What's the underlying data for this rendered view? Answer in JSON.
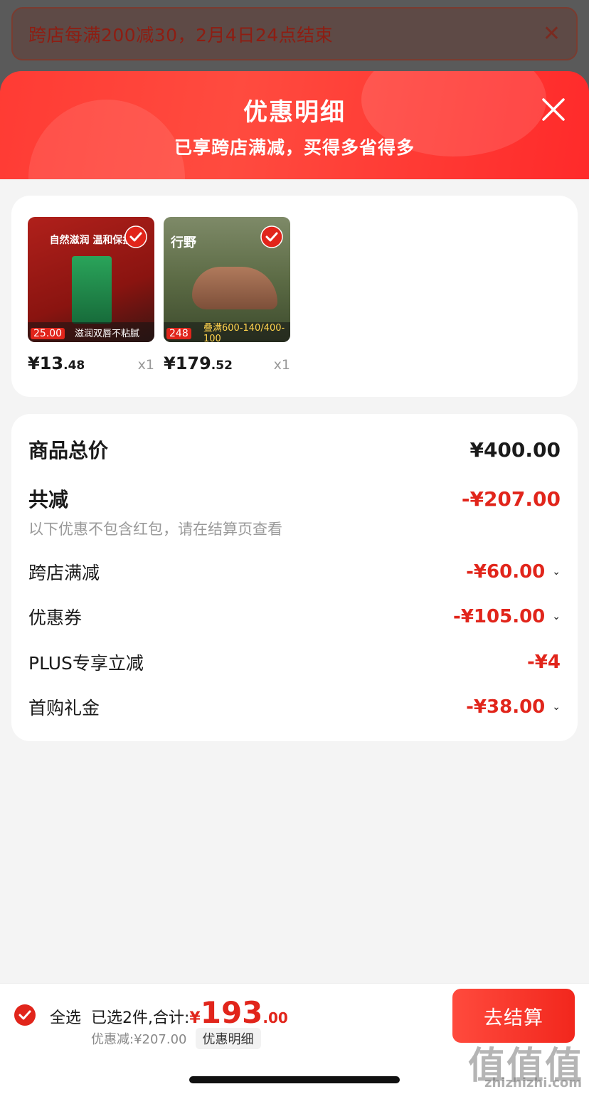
{
  "promo_banner": {
    "text": "跨店每满200减30，2月4日24点结束",
    "close_icon": "close-icon"
  },
  "sheet": {
    "title": "优惠明细",
    "subtitle": "已享跨店满减，买得多省得多"
  },
  "products": [
    {
      "price_int": "¥13",
      "price_dec": ".48",
      "qty": "x1",
      "slogan": "自然滋润 温和保护",
      "caption": "滋润双唇不粘腻",
      "tag_price": "25.00",
      "selected": true
    },
    {
      "price_int": "¥179",
      "price_dec": ".52",
      "qty": "x1",
      "slogan": "行野",
      "caption": "叠满600-140/400-100",
      "tag_price": "248",
      "selected": true
    }
  ],
  "summary": {
    "total_label": "商品总价",
    "total_value": "¥400.00",
    "reduce_label": "共减",
    "reduce_value": "-¥207.00",
    "note": "以下优惠不包含红包，请在结算页查看",
    "items": [
      {
        "label": "跨店满减",
        "value": "-¥60.00",
        "expandable": true
      },
      {
        "label": "优惠券",
        "value": "-¥105.00",
        "expandable": true
      },
      {
        "label": "PLUS专享立减",
        "value": "-¥4",
        "expandable": false
      },
      {
        "label": "首购礼金",
        "value": "-¥38.00",
        "expandable": true
      }
    ]
  },
  "bottom_bar": {
    "select_all": "全选",
    "selected_text": "已选2件,合计:",
    "total_yen": "¥",
    "total_int": "193",
    "total_dec": ".00",
    "discount_text": "优惠减:¥207.00",
    "detail_chip": "优惠明细",
    "checkout": "去结算"
  },
  "watermark": {
    "logo": "值值值",
    "url": "zhizhizhi.com"
  },
  "colors": {
    "accent": "#e1251b",
    "header_red": "#ff3b34"
  }
}
